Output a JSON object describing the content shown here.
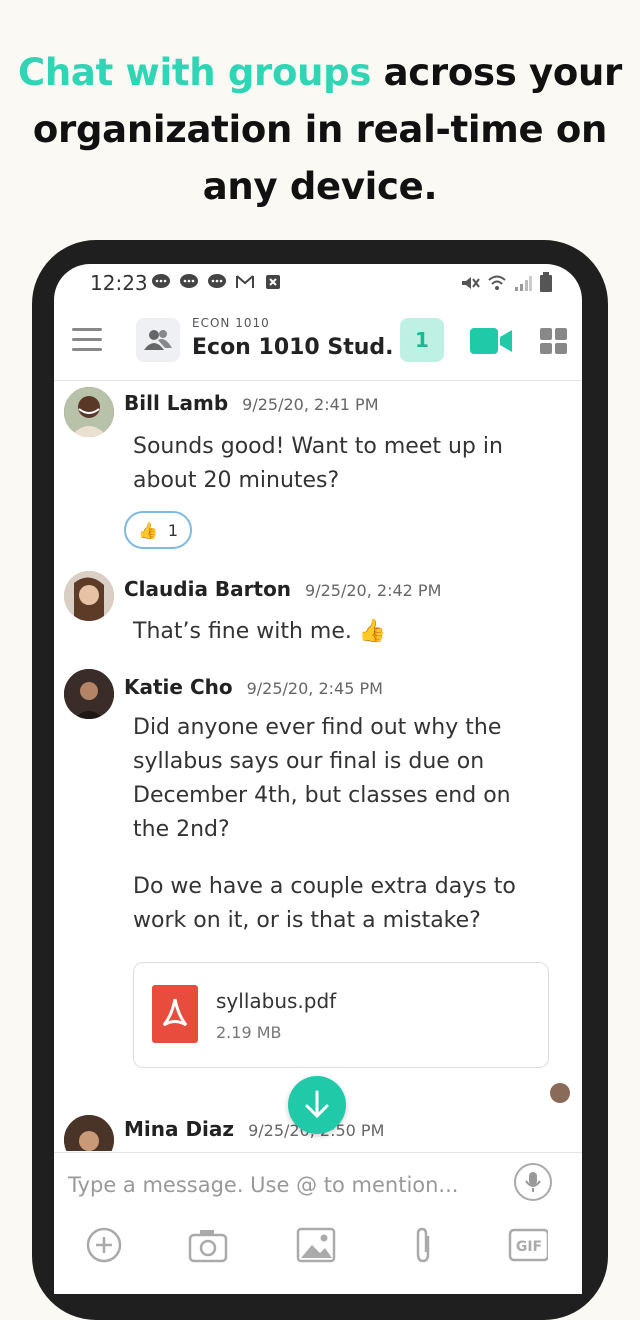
{
  "headline": {
    "accent": "Chat with groups",
    "rest": " across your organization in real-time on any device."
  },
  "status_bar": {
    "time": "12:23"
  },
  "header": {
    "group_code": "ECON 1010",
    "group_title": "Econ 1010 Stud...",
    "unread_count": "1"
  },
  "messages": [
    {
      "name": "Bill Lamb",
      "time": "9/25/20, 2:41 PM",
      "text": "Sounds good! Want to meet up in about 20 minutes?",
      "reaction": {
        "emoji": "👍",
        "count": "1"
      }
    },
    {
      "name": "Claudia Barton",
      "time": "9/25/20, 2:42 PM",
      "text": "That’s fine with me. 👍"
    },
    {
      "name": "Katie Cho",
      "time": "9/25/20, 2:45 PM",
      "text": "Did anyone ever find out why the syllabus says our final is due on December 4th, but classes end on the 2nd?",
      "text2": "Do we have a couple extra days to work on it, or is that a mistake?",
      "attachment": {
        "name": "syllabus.pdf",
        "size": "2.19 MB"
      }
    },
    {
      "name": "Mina Diaz",
      "time": "9/25/20, 2:50 PM"
    }
  ],
  "composer": {
    "placeholder": "Type a message. Use @ to mention..."
  },
  "colors": {
    "accent": "#2fd5b4",
    "teal_button": "#20c9a8",
    "badge_bg": "#bff0e4",
    "pdf_red": "#e74c3c"
  }
}
